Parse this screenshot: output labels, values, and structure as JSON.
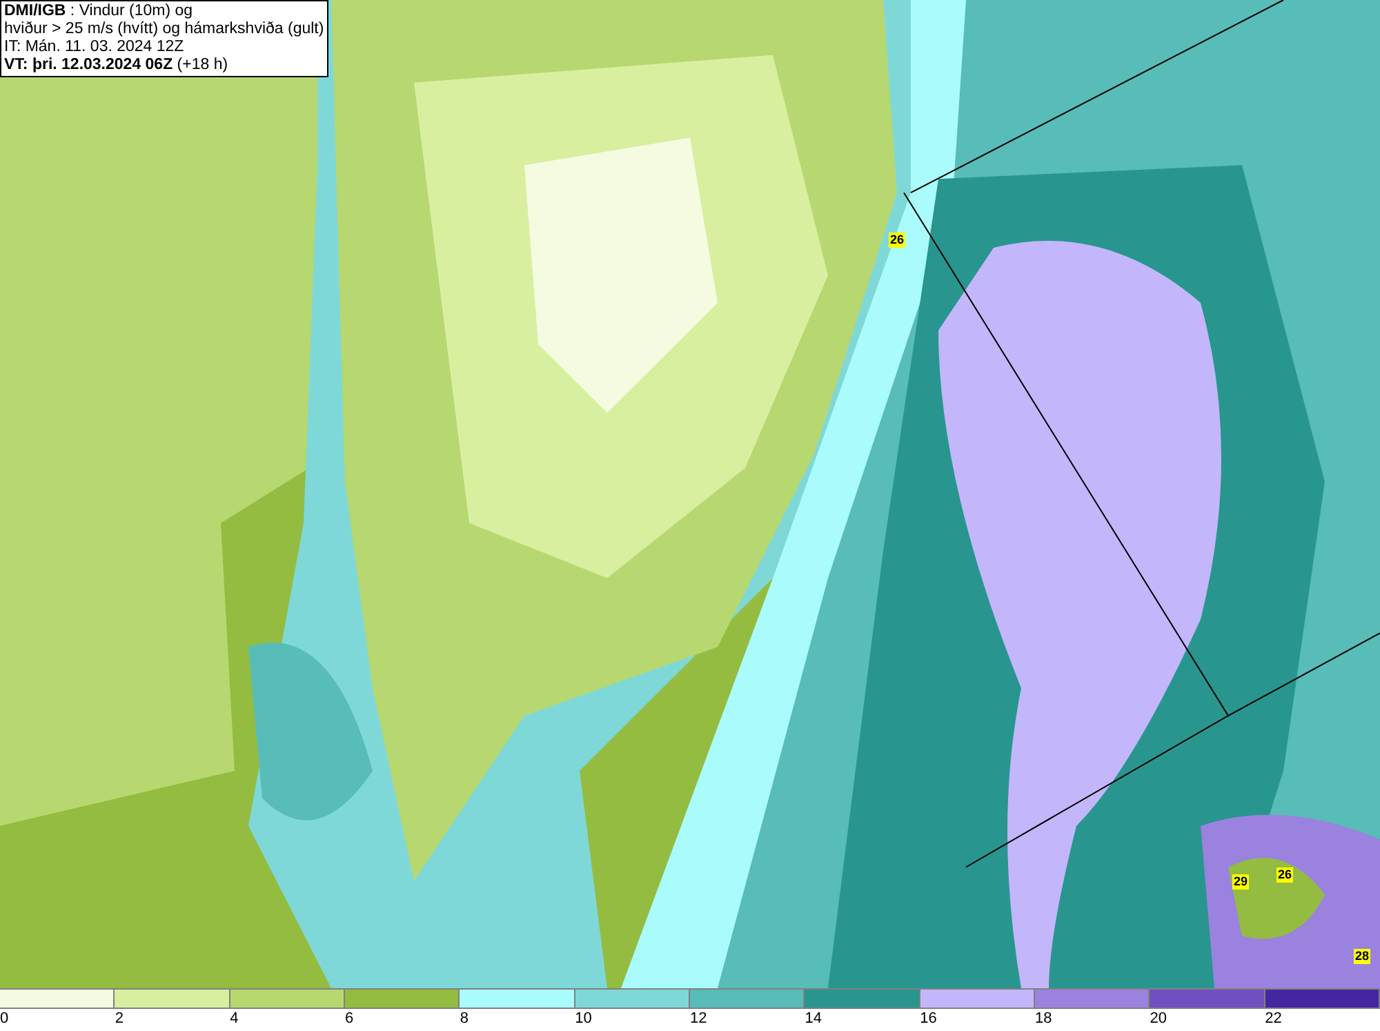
{
  "info_box": {
    "lines": [
      "**DMI/IGB** : Vindur (10m) og",
      "hviður > 25 m/s (hvítt) og hámarkshviða (gult)",
      "IT: Mán. 11. 03. 2024 12Z",
      "**VT: þri. 12.03.2024 06Z** (+18 h)"
    ]
  },
  "map": {
    "gust_labels": [
      {
        "text": "26"
      },
      {
        "text": "29"
      },
      {
        "text": "26"
      },
      {
        "text": "28"
      }
    ]
  },
  "legend": {
    "swatches": [
      {
        "color": "#f5fbe0"
      },
      {
        "color": "#d8efa0"
      },
      {
        "color": "#b7d870"
      },
      {
        "color": "#94bc40"
      },
      {
        "color": "#aafcfc"
      },
      {
        "color": "#7fd8d8"
      },
      {
        "color": "#58bcb8"
      },
      {
        "color": "#28968f"
      },
      {
        "color": "#c3b6fa"
      },
      {
        "color": "#9b82de"
      },
      {
        "color": "#7050c0"
      },
      {
        "color": "#4426a0"
      }
    ],
    "ticks": [
      "0",
      "2",
      "4",
      "6",
      "8",
      "10",
      "12",
      "14",
      "16",
      "18",
      "20",
      "22"
    ]
  }
}
